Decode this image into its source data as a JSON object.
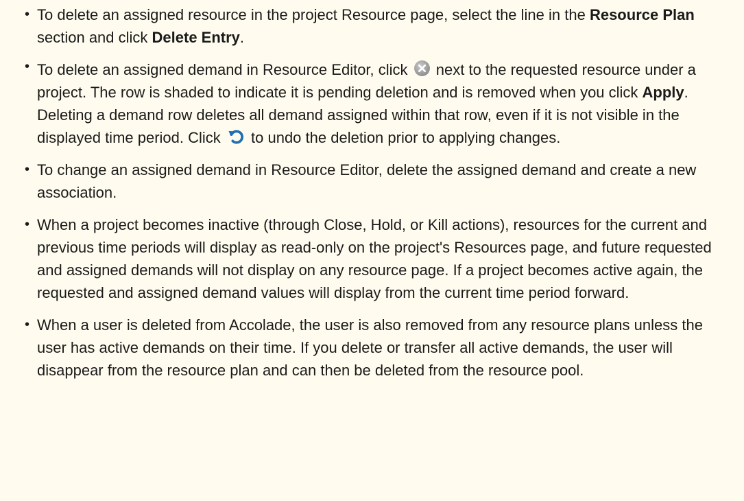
{
  "bullets": [
    {
      "p1": "To delete an assigned resource in the project Resource page, select the line in the ",
      "b1": "Resource Plan",
      "p2": " section and click ",
      "b2": "Delete Entry",
      "p3": "."
    },
    {
      "p1": "To delete an assigned demand in Resource Editor, click ",
      "delete_icon": "delete-circle-x-icon",
      "p2": " next to the requested resource under a project. The row is shaded to indicate it is pending deletion and is removed when you click ",
      "b1": "Apply",
      "p3": ". Deleting a demand row deletes all demand assigned within that row, even if it is not visible in the displayed time period. Click ",
      "undo_icon": "undo-arrow-icon",
      "p4": " to undo the deletion prior to applying changes."
    },
    {
      "p1": "To change an assigned demand in Resource Editor, delete the assigned demand and create a new association."
    },
    {
      "p1": "When a project becomes inactive (through Close, Hold, or Kill actions), resources for the current and previous time periods will display as read-only on the project's Resources page, and future requested and assigned demands will not display on any resource page. If a project becomes active again, the requested and assigned demand values will display from the current time period forward."
    },
    {
      "p1": "When a user is deleted from Accolade, the user is also removed from any resource plans unless the user has active demands on their time. If you delete or transfer all active demands, the user will disappear from the resource plan and can then be deleted from the resource pool."
    }
  ],
  "colors": {
    "background": "#fffcef",
    "text": "#1a1a1a",
    "delete_icon": "#9e9e9e",
    "undo_icon": "#1f6fb2"
  }
}
